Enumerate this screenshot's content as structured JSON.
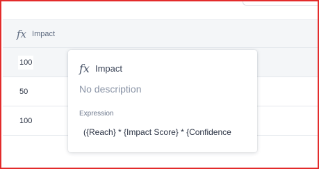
{
  "column": {
    "icon": "fx-formula-icon",
    "name": "Impact"
  },
  "rows": [
    {
      "value": "100"
    },
    {
      "value": "50"
    },
    {
      "value": "100"
    }
  ],
  "popover": {
    "icon": "fx-formula-icon",
    "name": "Impact",
    "description": "No description",
    "expression_label": "Expression",
    "expression": "({Reach} * {Impact Score} * {Confidence"
  }
}
